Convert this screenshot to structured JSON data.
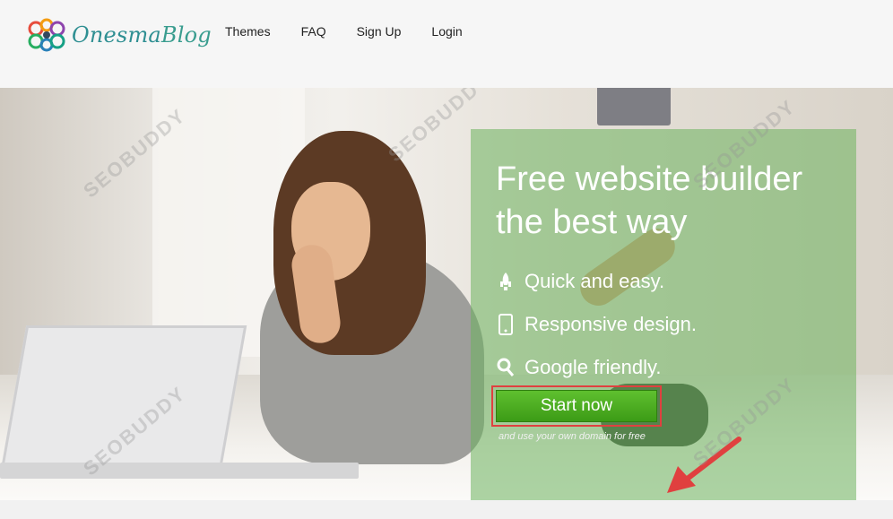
{
  "logo": {
    "part1": "Onesma",
    "part2": "Blog"
  },
  "nav": [
    "Themes",
    "FAQ",
    "Sign Up",
    "Login"
  ],
  "hero": {
    "title": "Free website builder the best way",
    "features": [
      {
        "icon": "rocket-icon",
        "text": "Quick and easy."
      },
      {
        "icon": "mobile-icon",
        "text": "Responsive design."
      },
      {
        "icon": "search-icon",
        "text": "Google friendly."
      }
    ],
    "cta": "Start now",
    "note": "and use your own domain for free"
  },
  "watermark": "SEOBUDDY",
  "colors": {
    "accent": "#4fab24",
    "panel": "#6cb25c",
    "highlight": "#e0403f"
  }
}
